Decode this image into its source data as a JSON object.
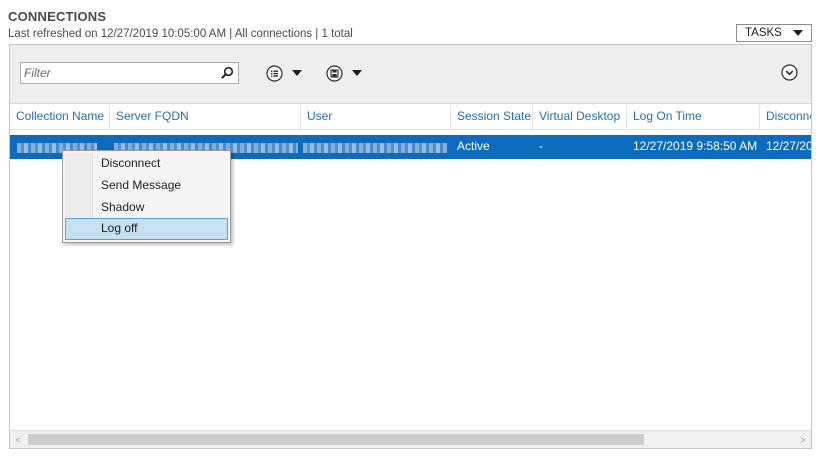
{
  "header": {
    "title": "CONNECTIONS",
    "subtitle": "Last refreshed on 12/27/2019 10:05:00 AM | All connections  | 1 total",
    "tasks_label": "TASKS"
  },
  "toolbar": {
    "filter_placeholder": "Filter",
    "icons": [
      "search-icon",
      "list-options-icon",
      "save-query-icon",
      "expand-icon"
    ]
  },
  "table": {
    "columns": [
      "Collection Name",
      "Server FQDN",
      "User",
      "Session State",
      "Virtual Desktop",
      "Log On Time",
      "Disconnect"
    ],
    "rows": [
      {
        "collection_name": "",
        "server_fqdn": "",
        "user": "",
        "session_state": "Active",
        "virtual_desktop": "-",
        "log_on_time": "12/27/2019 9:58:50 AM",
        "disconnect": "12/27/20"
      }
    ]
  },
  "context_menu": {
    "items": [
      "Disconnect",
      "Send Message",
      "Shadow",
      "Log off"
    ],
    "highlighted": "Log off"
  },
  "colors": {
    "selection": "#0d6bbd",
    "header_text": "#2c6fa6",
    "menu_highlight": "#c6e1f2"
  }
}
